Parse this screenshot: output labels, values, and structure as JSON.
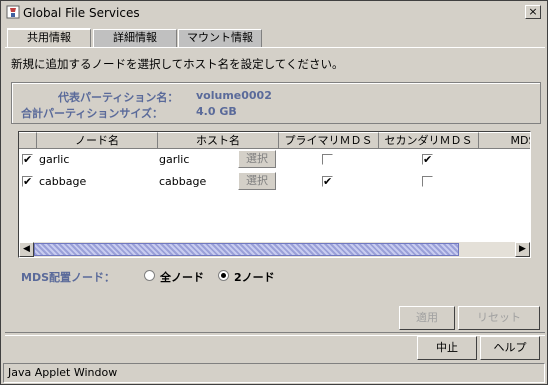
{
  "window": {
    "title": "Global File Services",
    "close_label": "×"
  },
  "tabs": [
    {
      "label": "共用情報",
      "active": true
    },
    {
      "label": "詳細情報",
      "active": false
    },
    {
      "label": "マウント情報",
      "active": false
    }
  ],
  "instruction": "新規に追加するノードを選択してホスト名を設定してください。",
  "info": {
    "partition_name_label": "代表パーティション名：",
    "partition_name_value": "volume0002",
    "partition_size_label": "合計パーティションサイズ：",
    "partition_size_value": "4.0 GB"
  },
  "table": {
    "columns": [
      "",
      "ノード名",
      "ホスト名",
      "プライマリＭＤＳ",
      "セカンダリＭＤＳ",
      "MDS配"
    ],
    "rows": [
      {
        "checked": true,
        "node": "garlic",
        "host": "garlic",
        "select_label": "選択",
        "primary": false,
        "secondary": true
      },
      {
        "checked": true,
        "node": "cabbage",
        "host": "cabbage",
        "select_label": "選択",
        "primary": true,
        "secondary": false
      }
    ],
    "scroll_left": "◀",
    "scroll_right": "▶"
  },
  "mds": {
    "label": "MDS配置ノード：",
    "options": [
      {
        "label": "全ノード",
        "selected": false
      },
      {
        "label": "2ノード",
        "selected": true
      }
    ]
  },
  "buttons": {
    "apply": "適用",
    "reset": "リセット",
    "stop": "中止",
    "help": "ヘルプ"
  },
  "status": "Java Applet Window",
  "checkmark": "✔"
}
